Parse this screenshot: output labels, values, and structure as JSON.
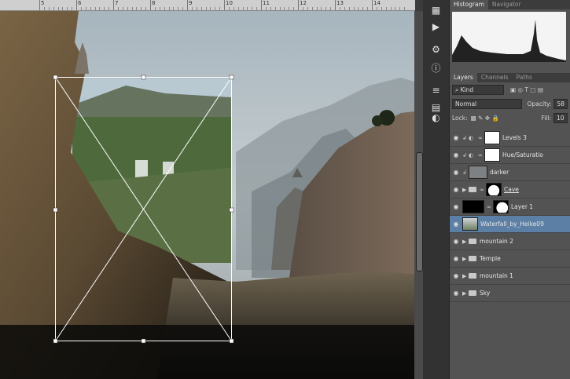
{
  "ruler": {
    "numbers": [
      "5",
      "6",
      "7",
      "8",
      "9",
      "10",
      "11",
      "12",
      "13",
      "14"
    ]
  },
  "toolstrip": {
    "tools": [
      "histogram-tool-icon",
      "play-icon",
      "channels-tool-icon",
      "info-icon",
      "properties-icon",
      "layer-comp-icon",
      "adjust-icon"
    ]
  },
  "panel": {
    "histogram_tabs": [
      {
        "label": "Histogram"
      },
      {
        "label": "Navigator"
      }
    ],
    "layer_tabs": [
      {
        "label": "Layers"
      },
      {
        "label": "Channels"
      },
      {
        "label": "Paths"
      }
    ],
    "kind_filter": "Kind",
    "blend_mode": "Normal",
    "opacity_label": "Opacity:",
    "opacity_value": "58",
    "lock_label": "Lock:",
    "fill_label": "Fill:",
    "fill_value": "10",
    "layers": [
      {
        "name": "Levels 3",
        "type": "adjust"
      },
      {
        "name": "Hue/Saturatio",
        "type": "adjust"
      },
      {
        "name": "darker",
        "type": "thumb"
      },
      {
        "name": "Cave",
        "type": "group-mask"
      },
      {
        "name": "Layer 1",
        "type": "mask"
      },
      {
        "name": "Waterfall_by_Heike09",
        "type": "selected"
      },
      {
        "name": "mountain 2",
        "type": "folder"
      },
      {
        "name": "Temple",
        "type": "folder"
      },
      {
        "name": "mountain 1",
        "type": "folder"
      },
      {
        "name": "Sky",
        "type": "folder"
      }
    ]
  },
  "colors": {
    "selected_layer": "#5c7fa6",
    "panel_bg": "#535353",
    "dark_bg": "#323232"
  }
}
